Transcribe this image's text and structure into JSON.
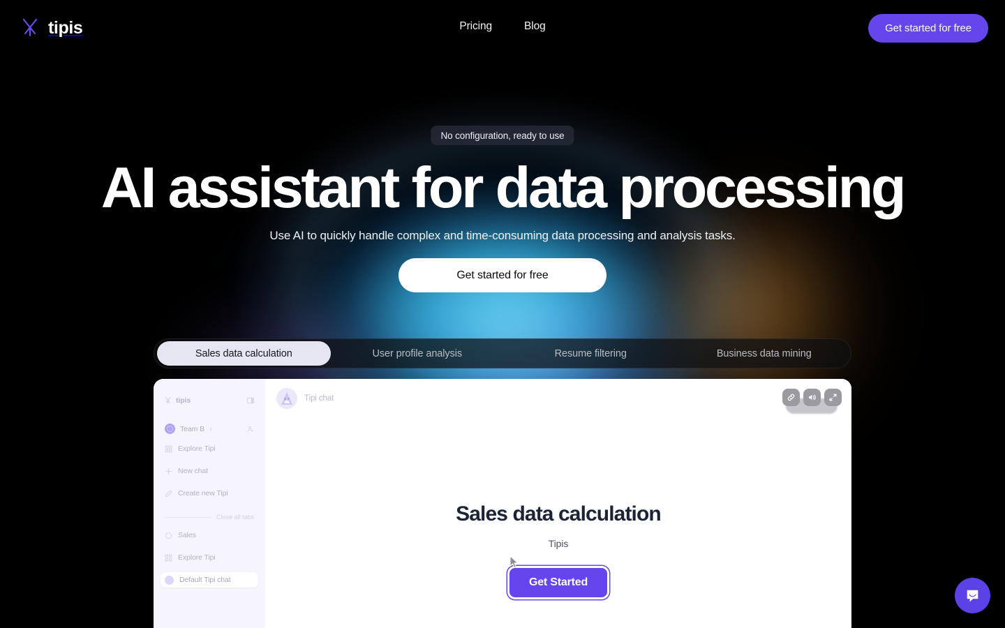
{
  "header": {
    "brand_name": "tipis",
    "brand_icon": "tipi-logo-icon",
    "nav": [
      {
        "label": "Pricing"
      },
      {
        "label": "Blog"
      }
    ],
    "cta_label": "Get started for free"
  },
  "hero": {
    "badge": "No configuration, ready to use",
    "title": "AI assistant for data processing",
    "subtitle": "Use AI to quickly handle complex and time-consuming data processing and analysis tasks.",
    "cta_label": "Get started for free"
  },
  "tabs": [
    {
      "label": "Sales data calculation",
      "active": true
    },
    {
      "label": "User profile analysis",
      "active": false
    },
    {
      "label": "Resume filtering",
      "active": false
    },
    {
      "label": "Business data mining",
      "active": false
    }
  ],
  "preview": {
    "sidebar": {
      "brand_name": "tipis",
      "brand_icon": "tipi-logo-icon",
      "panel_toggle_icon": "sidebar-toggle-icon",
      "team_name": "Team B",
      "team_chevron_icon": "chevron-updown-icon",
      "invite_icon": "add-user-icon",
      "items": [
        {
          "label": "Explore Tipi",
          "icon": "grid-icon"
        },
        {
          "label": "New chat",
          "icon": "plus-icon"
        },
        {
          "label": "Create new Tipi",
          "icon": "pencil-icon"
        }
      ],
      "divider_label": "Close all tabs",
      "tabs": [
        {
          "label": "Sales",
          "icon": "circle-icon",
          "active": false
        },
        {
          "label": "Explore Tipi",
          "icon": "grid-icon",
          "active": false
        },
        {
          "label": "Default Tipi chat",
          "icon": "avatar-icon",
          "active": true
        }
      ]
    },
    "topbar": {
      "chat_title": "Tipi chat",
      "avatar_icon": "tipi-avatar-icon"
    },
    "controls": [
      {
        "icon": "link-icon",
        "name": "copy-link-button"
      },
      {
        "icon": "speaker-icon",
        "name": "sound-toggle-button"
      },
      {
        "icon": "expand-icon",
        "name": "fullscreen-button"
      }
    ],
    "empty_state": {
      "title": "Sales data calculation",
      "subtitle": "Tipis",
      "button_label": "Get Started"
    }
  },
  "widget": {
    "launcher_icon": "chat-bubble-icon"
  },
  "colors": {
    "brand_purple": "#6545ec",
    "intercom_purple": "#5b41e8",
    "glow_cyan": "#50cdf0",
    "glow_amber": "#d6963c",
    "page_bg": "#000000",
    "card_bg": "#ffffff",
    "sidebar_bg": "#f6f5fd",
    "tab_active_bg": "#e6e6f2",
    "empty_title": "#1b2336"
  }
}
